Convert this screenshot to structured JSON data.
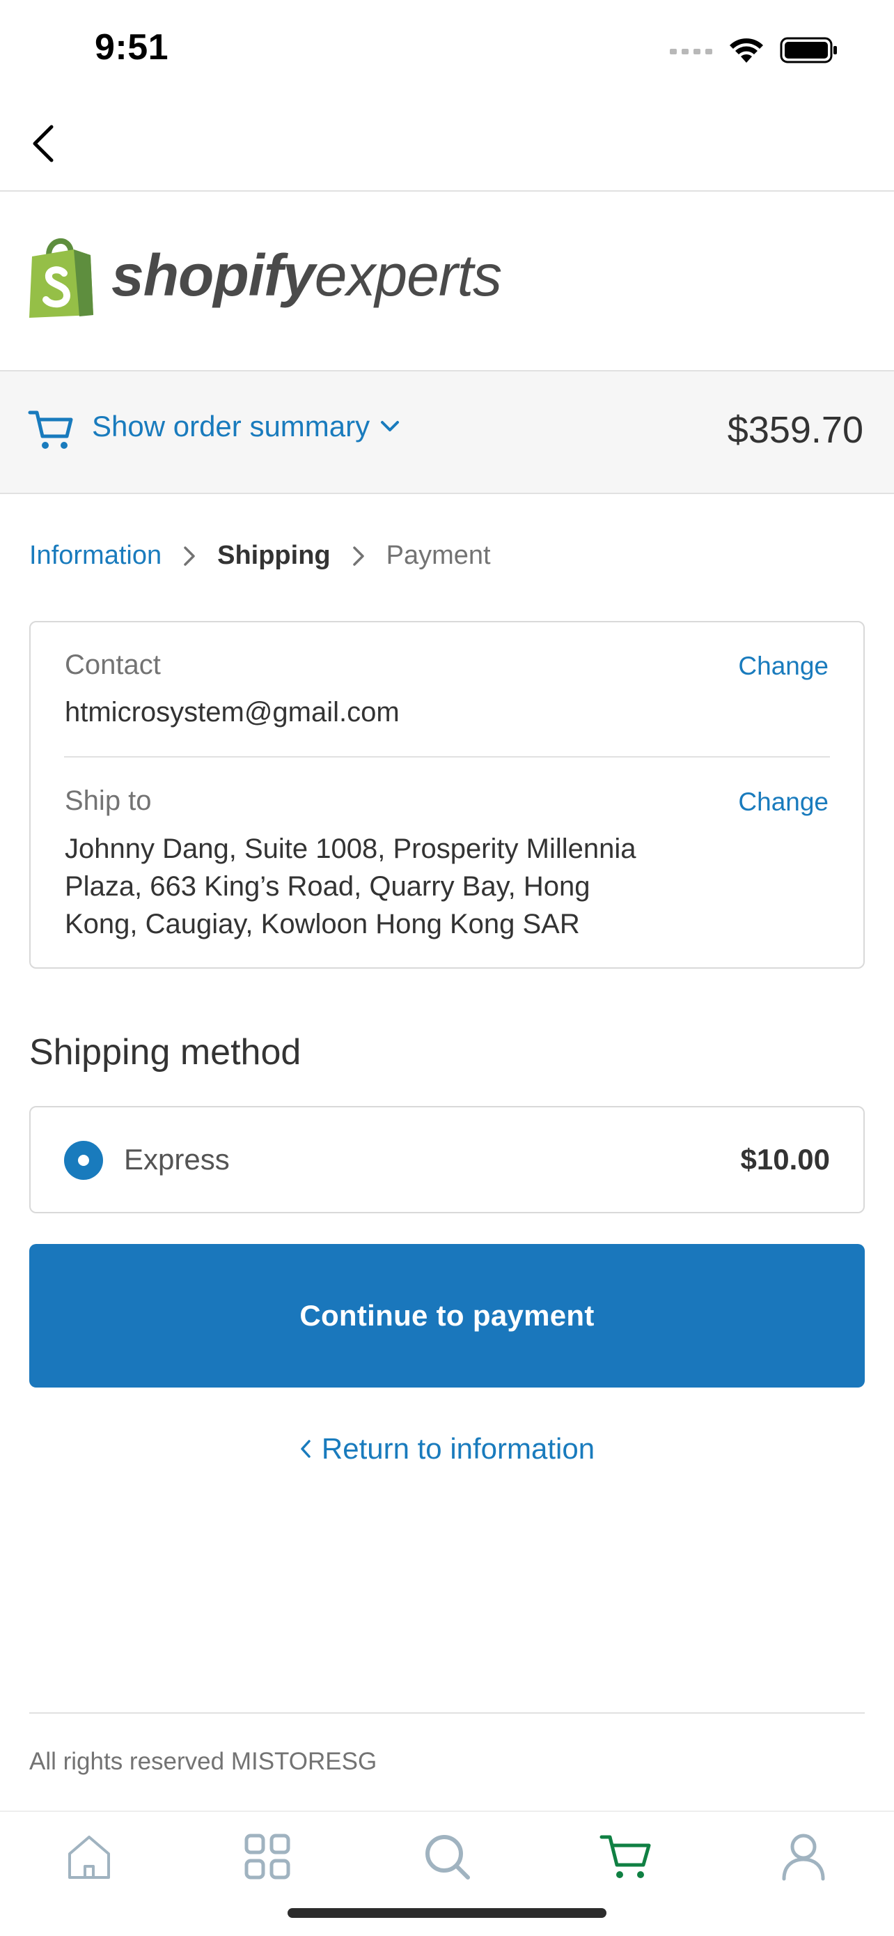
{
  "status_bar": {
    "time": "9:51"
  },
  "logo": {
    "brand_bold": "shopify",
    "brand_light": "experts"
  },
  "order_summary": {
    "toggle_label": "Show order summary",
    "total": "$359.70"
  },
  "breadcrumb": {
    "items": [
      {
        "label": "Information",
        "state": "link"
      },
      {
        "label": "Shipping",
        "state": "current"
      },
      {
        "label": "Payment",
        "state": "upcoming"
      }
    ]
  },
  "review": {
    "contact": {
      "label": "Contact",
      "value": "htmicrosystem@gmail.com",
      "change_label": "Change"
    },
    "ship_to": {
      "label": "Ship to",
      "lines": [
        "Johnny Dang, Suite 1008, Prosperity Millennia",
        "Plaza, 663 King’s Road, Quarry Bay, Hong",
        "Kong, Caugiay, Kowloon Hong Kong SAR"
      ],
      "change_label": "Change"
    }
  },
  "shipping_method": {
    "heading": "Shipping method",
    "option": {
      "label": "Express",
      "price": "$10.00",
      "selected": true
    }
  },
  "actions": {
    "continue_label": "Continue to payment",
    "return_label": "Return to information"
  },
  "footer": {
    "text": "All rights reserved MISTORESG"
  },
  "tab_bar": {
    "tabs": [
      {
        "icon": "home-icon",
        "active": false
      },
      {
        "icon": "grid-icon",
        "active": false
      },
      {
        "icon": "search-icon",
        "active": false
      },
      {
        "icon": "cart-icon",
        "active": true
      },
      {
        "icon": "profile-icon",
        "active": false
      }
    ]
  },
  "colors": {
    "accent": "#197bbd",
    "button": "#1a77bc",
    "logo_green": "#95bf47",
    "tab_active": "#108043",
    "tab_inactive": "#a0b3c0"
  }
}
